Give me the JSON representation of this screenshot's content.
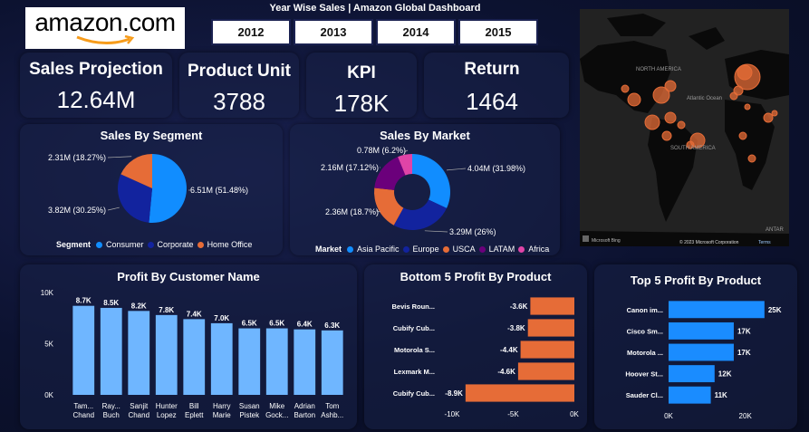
{
  "header": {
    "logo_text": "amazon.com",
    "title": "Year Wise Sales | Amazon Global Dashboard",
    "years": [
      "2012",
      "2013",
      "2014",
      "2015"
    ]
  },
  "kpis": [
    {
      "label": "Sales Projection",
      "value": "12.64M"
    },
    {
      "label": "Product Unit",
      "value": "3788"
    },
    {
      "label": "KPI",
      "value": "178K"
    },
    {
      "label": "Return",
      "value": "1464"
    }
  ],
  "map": {
    "labels": [
      "NORTH AMERICA",
      "Atlantic Ocean",
      "SOUTH AMERICA",
      "ANTAR"
    ],
    "attribution_left": "Microsoft Bing",
    "attribution_right": "© 2023 Microsoft Corporation",
    "terms": "Terms"
  },
  "colors": {
    "blue": "#118dff",
    "navy": "#12239e",
    "orange": "#e66c37",
    "purple": "#6b007b",
    "pink": "#e044a7",
    "light_blue": "#6fb6ff",
    "bar_blue": "#1a8cff"
  },
  "chart_data": [
    {
      "type": "pie",
      "title": "Sales By Segment",
      "legend_title": "Segment",
      "legend_position": "bottom",
      "categories": [
        "Consumer",
        "Corporate",
        "Home Office"
      ],
      "values": [
        6.51,
        3.82,
        2.31
      ],
      "percents": [
        51.48,
        30.25,
        18.27
      ],
      "labels": [
        "6.51M (51.48%)",
        "3.82M (30.25%)",
        "2.31M (18.27%)"
      ],
      "colors": [
        "#118dff",
        "#12239e",
        "#e66c37"
      ]
    },
    {
      "type": "pie",
      "subtype": "donut",
      "title": "Sales By Market",
      "legend_title": "Market",
      "legend_position": "bottom",
      "categories": [
        "Asia Pacific",
        "Europe",
        "USCA",
        "LATAM",
        "Africa"
      ],
      "values": [
        4.04,
        3.29,
        2.36,
        2.16,
        0.78
      ],
      "percents": [
        31.98,
        26,
        18.7,
        17.12,
        6.2
      ],
      "labels": [
        "4.04M (31.98%)",
        "3.29M (26%)",
        "2.36M (18.7%)",
        "2.16M (17.12%)",
        "0.78M (6.2%)"
      ],
      "colors": [
        "#118dff",
        "#12239e",
        "#e66c37",
        "#6b007b",
        "#e044a7"
      ]
    },
    {
      "type": "bar",
      "title": "Profit By Customer Name",
      "categories": [
        [
          "Tam...",
          "Chand"
        ],
        [
          "Ray...",
          "Buch"
        ],
        [
          "Sanjit",
          "Chand"
        ],
        [
          "Hunter",
          "Lopez"
        ],
        [
          "Bill",
          "Eplett"
        ],
        [
          "Harry",
          "Marie"
        ],
        [
          "Susan",
          "Pistek"
        ],
        [
          "Mike",
          "Gock..."
        ],
        [
          "Adrian",
          "Barton"
        ],
        [
          "Tom",
          "Ashb..."
        ]
      ],
      "values": [
        8.7,
        8.5,
        8.2,
        7.8,
        7.4,
        7.0,
        6.5,
        6.5,
        6.4,
        6.3
      ],
      "data_labels": [
        "8.7K",
        "8.5K",
        "8.2K",
        "7.8K",
        "7.4K",
        "7.0K",
        "6.5K",
        "6.5K",
        "6.4K",
        "6.3K"
      ],
      "y_ticks": [
        "0K",
        "5K",
        "10K"
      ],
      "ylim": [
        0,
        10
      ],
      "color": "#6fb6ff"
    },
    {
      "type": "bar",
      "orientation": "horizontal",
      "title": "Bottom 5 Profit By Product",
      "categories": [
        "Bevis Roun...",
        "Cubify Cub...",
        "Motorola S...",
        "Lexmark M...",
        "Cubify Cub..."
      ],
      "values": [
        -3.6,
        -3.8,
        -4.4,
        -4.6,
        -8.9
      ],
      "data_labels": [
        "-3.6K",
        "-3.8K",
        "-4.4K",
        "-4.6K",
        "-8.9K"
      ],
      "x_ticks": [
        "-10K",
        "-5K",
        "0K"
      ],
      "xlim": [
        -10,
        0
      ],
      "color": "#e66c37"
    },
    {
      "type": "bar",
      "orientation": "horizontal",
      "title": "Top 5 Profit By Product",
      "categories": [
        "Canon im...",
        "Cisco Sm...",
        "Motorola ...",
        "Hoover St...",
        "Sauder Cl..."
      ],
      "values": [
        25,
        17,
        17,
        12,
        11
      ],
      "data_labels": [
        "25K",
        "17K",
        "17K",
        "12K",
        "11K"
      ],
      "x_ticks": [
        "0K",
        "20K"
      ],
      "xlim": [
        0,
        30
      ],
      "color": "#1a8cff"
    }
  ]
}
